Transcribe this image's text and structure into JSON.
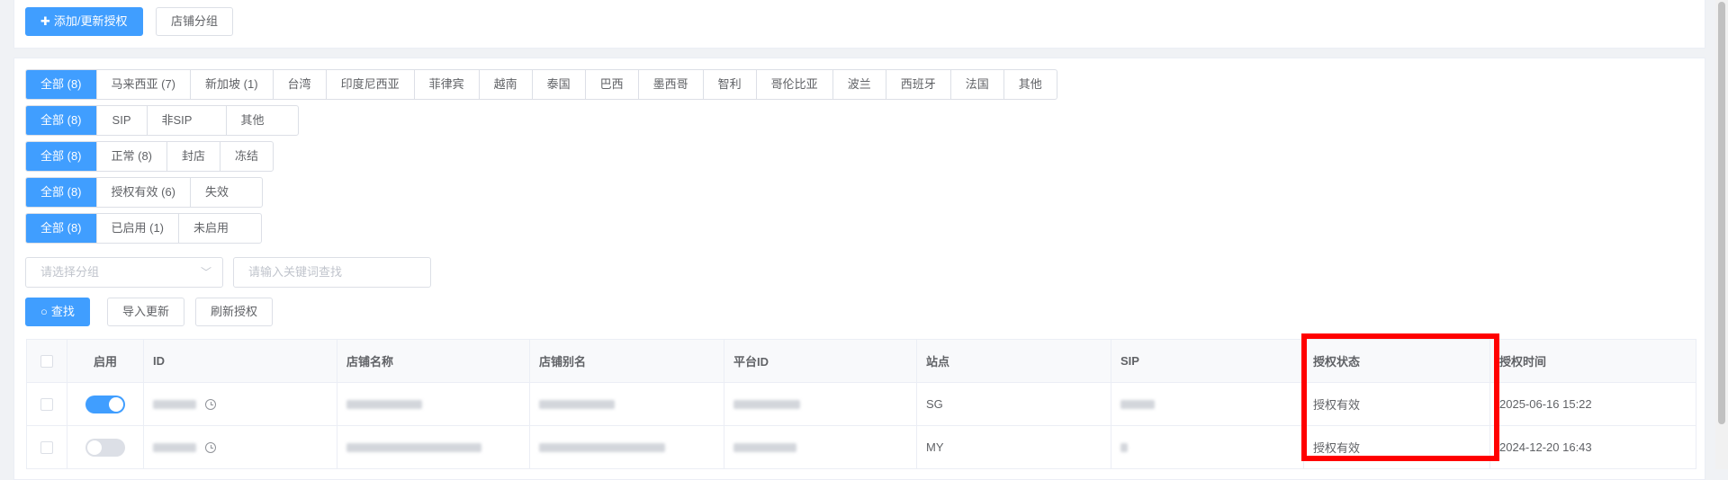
{
  "toolbar": {
    "add_update_label": "添加/更新授权",
    "add_icon": "plus-icon",
    "store_group_label": "店铺分组"
  },
  "filters": {
    "region": [
      "全部 (8)",
      "马来西亚 (7)",
      "新加坡 (1)",
      "台湾",
      "印度尼西亚",
      "菲律宾",
      "越南",
      "泰国",
      "巴西",
      "墨西哥",
      "智利",
      "哥伦比亚",
      "波兰",
      "西班牙",
      "法国",
      "其他"
    ],
    "sip": [
      "全部 (8)",
      "SIP",
      "非SIP",
      "其他"
    ],
    "status": [
      "全部 (8)",
      "正常 (8)",
      "封店",
      "冻结"
    ],
    "auth": [
      "全部 (8)",
      "授权有效 (6)",
      "失效"
    ],
    "enabled": [
      "全部 (8)",
      "已启用 (1)",
      "未启用"
    ]
  },
  "search": {
    "group_placeholder": "请选择分组",
    "keyword_placeholder": "请输入关键词查找",
    "search_label": "查找",
    "search_icon": "search-icon",
    "import_label": "导入更新",
    "refresh_label": "刷新授权"
  },
  "table": {
    "headers": {
      "enable": "启用",
      "id": "ID",
      "store_name": "店铺名称",
      "store_alias": "店铺别名",
      "platform_id": "平台ID",
      "site": "站点",
      "sip": "SIP",
      "auth_status": "授权状态",
      "auth_time": "授权时间"
    },
    "rows": [
      {
        "enabled": true,
        "site": "SG",
        "auth_status": "授权有效",
        "auth_time": "2025-06-16 15:22"
      },
      {
        "enabled": false,
        "site": "MY",
        "auth_status": "授权有效",
        "auth_time": "2024-12-20 16:43"
      }
    ]
  },
  "colors": {
    "primary": "#409eff",
    "highlight": "#ff0000"
  }
}
